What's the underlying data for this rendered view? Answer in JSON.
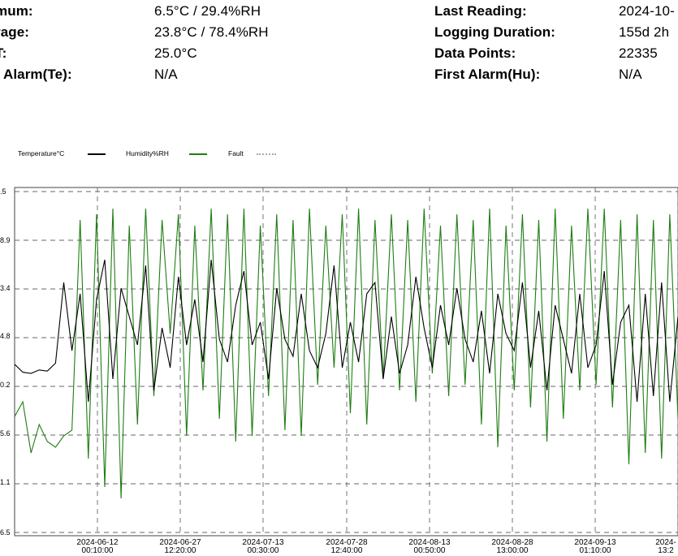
{
  "summary": {
    "left": [
      {
        "label": "mum:",
        "value": "6.5°C / 29.4%RH"
      },
      {
        "label": "rage:",
        "value": "23.8°C / 78.4%RH"
      },
      {
        "label": "T:",
        "value": "25.0°C"
      },
      {
        "label": "t Alarm(Te):",
        "value": "N/A"
      }
    ],
    "right": [
      {
        "label": "Last Reading:",
        "value": "2024-10-"
      },
      {
        "label": "Logging Duration:",
        "value": "155d 2h"
      },
      {
        "label": "Data Points:",
        "value": "22335"
      },
      {
        "label": "First Alarm(Hu):",
        "value": "N/A"
      }
    ]
  },
  "legend": {
    "temperature": "Temperature°C",
    "humidity": "Humidity%RH",
    "fault": "Fault"
  },
  "colors": {
    "temperature": "#000000",
    "humidity": "#1e7d12",
    "fault": "#aaaaaa",
    "grid": "#666666"
  },
  "chart_data": {
    "type": "line",
    "y_ticks": [
      ".5",
      "8.9",
      "3.4",
      "4.8",
      "0.2",
      "5.6",
      "1.1",
      "6.5"
    ],
    "x_ticks": [
      {
        "date": "2024-06-12",
        "time": "00:10:00"
      },
      {
        "date": "2024-06-27",
        "time": "12:20:00"
      },
      {
        "date": "2024-07-13",
        "time": "00:30:00"
      },
      {
        "date": "2024-07-28",
        "time": "12:40:00"
      },
      {
        "date": "2024-08-13",
        "time": "00:50:00"
      },
      {
        "date": "2024-08-28",
        "time": "13:00:00"
      },
      {
        "date": "2024-09-13",
        "time": "01:10:00"
      },
      {
        "date": "2024-",
        "time": "13:2"
      }
    ],
    "grid": true,
    "series": [
      {
        "name": "Temperature°C",
        "values": [
          14.8,
          14.1,
          14.0,
          14.3,
          14.2,
          14.9,
          22.0,
          16.0,
          21.0,
          11.5,
          20.5,
          24.0,
          13.5,
          21.5,
          19.0,
          16.5,
          23.5,
          12.5,
          18.0,
          14.5,
          22.5,
          16.5,
          20.5,
          15.0,
          24.0,
          17.0,
          15.0,
          20.0,
          23.0,
          16.5,
          18.5,
          13.5,
          21.5,
          17.0,
          15.5,
          21.0,
          16.0,
          14.5,
          17.5,
          23.5,
          14.5,
          18.5,
          15.0,
          21.0,
          22.0,
          13.5,
          19.0,
          14.0,
          16.5,
          22.5,
          18.0,
          14.5,
          20.0,
          16.5,
          21.5,
          17.0,
          15.0,
          19.5,
          14.0,
          21.0,
          17.5,
          16.0,
          22.0,
          14.5,
          19.5,
          12.5,
          20.0,
          17.0,
          14.0,
          21.0,
          14.5,
          16.5,
          23.0,
          13.0,
          18.5,
          20.0,
          11.5,
          21.0,
          12.0,
          22.0,
          11.5,
          19.0
        ],
        "y_range_note": "relative scale"
      },
      {
        "name": "Humidity%RH",
        "values": [
          10.2,
          11.5,
          7.0,
          9.5,
          8.0,
          7.5,
          8.5,
          9.0,
          27.5,
          6.5,
          28.0,
          4.0,
          28.5,
          3.0,
          27.0,
          9.5,
          28.5,
          12.0,
          27.5,
          17.5,
          28.0,
          8.5,
          27.0,
          12.5,
          28.5,
          10.0,
          28.0,
          8.0,
          28.5,
          8.5,
          27.0,
          12.0,
          28.0,
          9.0,
          27.5,
          8.5,
          28.5,
          13.0,
          27.0,
          14.5,
          28.0,
          10.5,
          28.5,
          9.5,
          27.5,
          13.5,
          28.0,
          12.5,
          27.5,
          11.5,
          28.5,
          14.0,
          27.0,
          12.0,
          28.0,
          13.0,
          27.5,
          9.5,
          28.5,
          7.5,
          27.0,
          12.5,
          28.0,
          11.0,
          27.5,
          8.0,
          28.5,
          10.0,
          27.0,
          12.5,
          28.5,
          13.0,
          28.5,
          11.0,
          27.5,
          6.0,
          28.0,
          7.0,
          27.5,
          6.5,
          28.0,
          10.0
        ]
      }
    ]
  }
}
